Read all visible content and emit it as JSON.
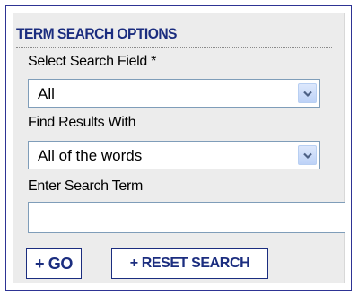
{
  "panel": {
    "title": "TERM SEARCH OPTIONS"
  },
  "search_field": {
    "label": "Select Search Field *",
    "value": "All"
  },
  "find_results": {
    "label": "Find Results With",
    "value": "All of the words"
  },
  "search_term": {
    "label": "Enter Search Term",
    "value": ""
  },
  "buttons": {
    "go_label": "+ GO",
    "reset_label": "+ RESET SEARCH"
  },
  "colors": {
    "title": "#1b2d7f",
    "frame_border": "#2e3494",
    "panel_bg": "#ececec",
    "field_border": "#7f9db9",
    "button_border": "#1b2d7f"
  },
  "icons": {
    "dropdown": "chevron-down-icon"
  }
}
